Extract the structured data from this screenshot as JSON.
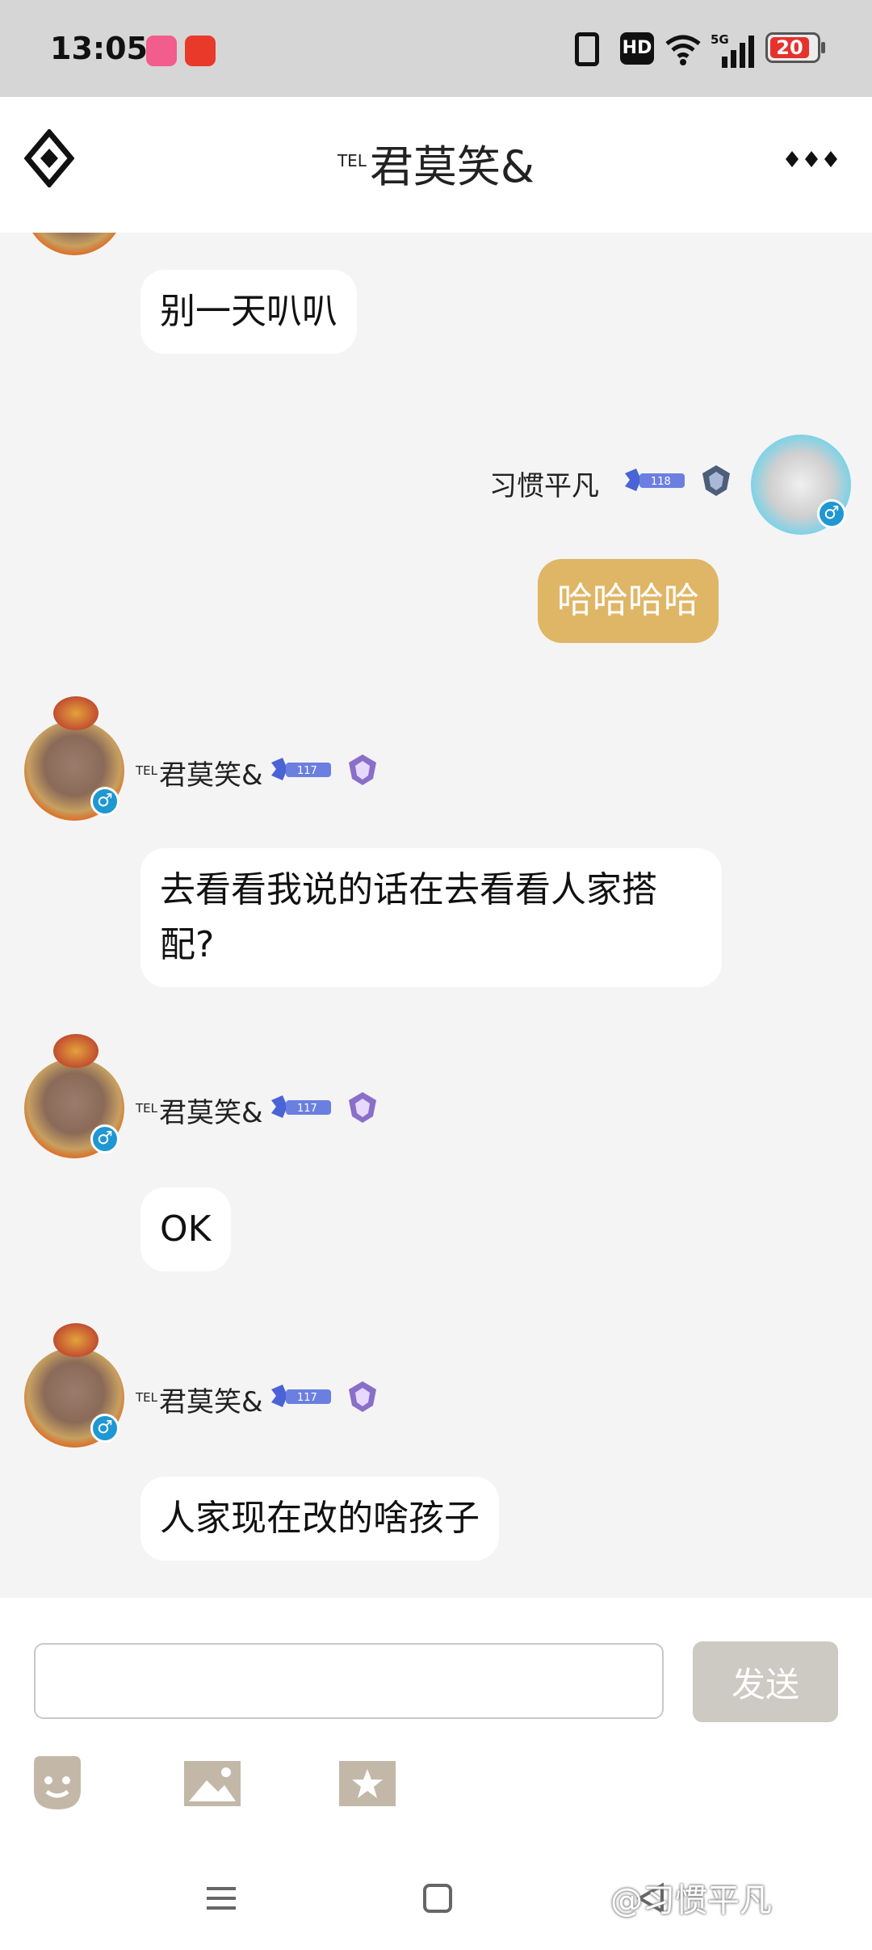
{
  "status_bar": {
    "time": "13:05",
    "network_badge": "HD",
    "signal_label": "5G",
    "battery_level": "20",
    "icons": [
      "bilibili-app-icon",
      "dnf-app-icon",
      "vibrate-icon",
      "hd-icon",
      "wifi-icon",
      "signal-icon",
      "battery-icon"
    ]
  },
  "header": {
    "title_prefix": "TEL",
    "title": "君莫笑&",
    "back_icon": "diamond-back-icon",
    "more_icon": "more-dots-icon"
  },
  "colors": {
    "self_bubble": "#dfb666",
    "other_bubble": "#ffffff",
    "chat_background": "#f4f4f4",
    "send_button": "#cdc9c3",
    "gender_badge": "#1e97d3"
  },
  "messages": [
    {
      "sender": "other",
      "text": "别一天叭叭"
    },
    {
      "sender": "self",
      "name": "习惯平凡",
      "rank_level": "118",
      "text": "哈哈哈哈"
    },
    {
      "sender": "other",
      "name_prefix": "TEL",
      "name": "君莫笑&",
      "rank_level": "117",
      "text": "去看看我说的话在去看看人家搭配?"
    },
    {
      "sender": "other",
      "name_prefix": "TEL",
      "name": "君莫笑&",
      "rank_level": "117",
      "text": "OK"
    },
    {
      "sender": "other",
      "name_prefix": "TEL",
      "name": "君莫笑&",
      "rank_level": "117",
      "text": "人家现在改的啥孩子"
    }
  ],
  "input_bar": {
    "value": "",
    "placeholder": "",
    "send_label": "发送",
    "tools": [
      "emoji-icon",
      "image-icon",
      "sticker-icon"
    ]
  },
  "nav_bar": {
    "buttons": [
      "menu-icon",
      "home-icon",
      "back-icon"
    ]
  },
  "watermark": "@习惯平凡"
}
